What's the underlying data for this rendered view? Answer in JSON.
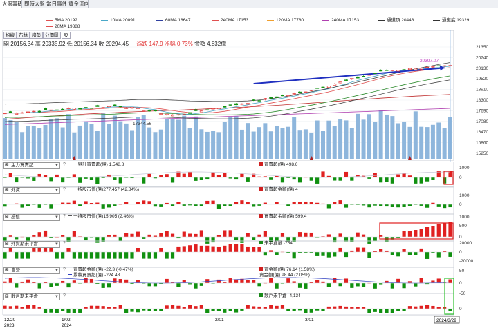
{
  "tabs": [
    "大盤籌碼",
    "即時大盤",
    "當日事件",
    "資金流向"
  ],
  "legend": [
    {
      "label": "5MA 20192",
      "color": "#e05050"
    },
    {
      "label": "10MA 20091",
      "color": "#4aa8c8"
    },
    {
      "label": "60MA 18647",
      "color": "#3040a0"
    },
    {
      "label": "240MA 17153",
      "color": "#e05050"
    },
    {
      "label": "120MA 17780",
      "color": "#f0a030"
    },
    {
      "label": "240MA 17153",
      "color": "#b040b0"
    },
    {
      "label": "通道頂 20448",
      "color": "#333333"
    },
    {
      "label": "通道底 19329",
      "color": "#333333"
    },
    {
      "label": "20MA 19888",
      "color": "#e05050"
    }
  ],
  "subtabs": [
    "均線",
    "布林",
    "趨勢",
    "分價圖",
    "股"
  ],
  "quote": {
    "open": "開 20156.34",
    "high": "高 20335.92",
    "low": "低 20156.34",
    "close": "收 20294.45",
    "change": "漲跌 147.9",
    "pct": "漲幅",
    "pct_value": "0.73%",
    "amount": "金額 4,832億"
  },
  "price_axis": [
    "21350",
    "20740",
    "20130",
    "19520",
    "18910",
    "18300",
    "17690",
    "17080",
    "16470",
    "15860",
    "15250"
  ],
  "price_annotations": {
    "high": "20397.07",
    "low": "17344.56"
  },
  "panels": [
    {
      "title": "主力買賣超",
      "labels": [
        {
          "kind": "line",
          "color": "#8a2be2",
          "text": "一累計買賣超(億) 1,548.8"
        },
        {
          "kind": "box",
          "color": "#d02020",
          "text": "買賣超(億) 498.6"
        }
      ],
      "axis": [
        "1000",
        "0"
      ]
    },
    {
      "title": "外資",
      "labels": [
        {
          "kind": "line",
          "color": "#555555",
          "text": "一持股市值(億)277,457 (42.84%)"
        },
        {
          "kind": "box",
          "color": "#d02020",
          "text": "買賣超金額(億) 4"
        }
      ],
      "axis": [
        "1000",
        "0"
      ]
    },
    {
      "title": "投信",
      "labels": [
        {
          "kind": "line",
          "color": "#555555",
          "text": "一持股市值(億)15,905 (2.46%)"
        },
        {
          "kind": "box",
          "color": "#d02020",
          "text": "買賣超金額(億) 599.4"
        }
      ],
      "axis": [
        "1000",
        "500",
        "0"
      ]
    },
    {
      "title": "外資期未平倉",
      "labels": [
        {
          "kind": "box",
          "color": "#1a8a1a",
          "text": "未平倉量 -754"
        }
      ],
      "axis": [
        "20000",
        "0",
        "-20000"
      ]
    },
    {
      "title": "自營",
      "labels": [
        {
          "kind": "line",
          "color": "#3040c0",
          "text": "買賣超金額(億) -22.3 (-0.47%)"
        },
        {
          "kind": "line",
          "color": "#3040c0",
          "text": "累積買賣超(億) -224.48"
        },
        {
          "kind": "box",
          "color": "#d02020",
          "text": "買金額(億) 76.14 (1.58%)"
        },
        {
          "kind": "none",
          "color": "#222222",
          "text": "賣金額(億) 98.44 (2.05%)"
        }
      ],
      "axis": [
        "50",
        "0",
        "-50"
      ]
    },
    {
      "title": "散戶期未平倉",
      "labels": [
        {
          "kind": "box",
          "color": "#1a8a1a",
          "text": "散戶未平倉 -4,134"
        }
      ],
      "axis": [
        "0"
      ]
    }
  ],
  "x_axis": [
    {
      "label": "12/20",
      "sub": "2023"
    },
    {
      "label": "1/02",
      "sub": "2024"
    },
    {
      "label": "2/01",
      "sub": ""
    },
    {
      "label": "3/01",
      "sub": ""
    },
    {
      "label": "2024/3/29",
      "sub": ""
    }
  ],
  "colors": {
    "up": "#e02020",
    "down": "#109010",
    "volume": "#8eb6dc",
    "highlight": "#e02020",
    "highlight_green": "#30c030"
  }
}
